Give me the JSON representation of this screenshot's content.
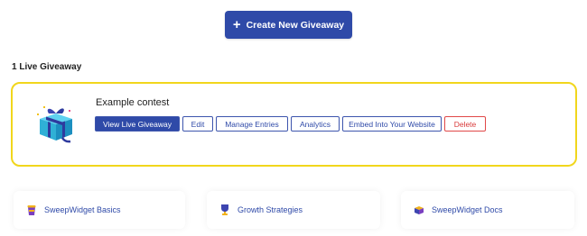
{
  "create_button": {
    "label": "Create New Giveaway"
  },
  "live_count_label": "1 Live Giveaway",
  "giveaway": {
    "title": "Example contest",
    "actions": {
      "view_live": "View Live Giveaway",
      "edit": "Edit",
      "manage_entries": "Manage Entries",
      "analytics": "Analytics",
      "embed": "Embed Into Your Website",
      "delete": "Delete"
    }
  },
  "resources": [
    {
      "label": "SweepWidget Basics",
      "icon": "coffee-cup-icon"
    },
    {
      "label": "Growth Strategies",
      "icon": "trophy-icon"
    },
    {
      "label": "SweepWidget Docs",
      "icon": "box-icon"
    }
  ],
  "colors": {
    "primary": "#2f4aa8",
    "highlight_border": "#f1d61c",
    "danger": "#d93b3b"
  }
}
